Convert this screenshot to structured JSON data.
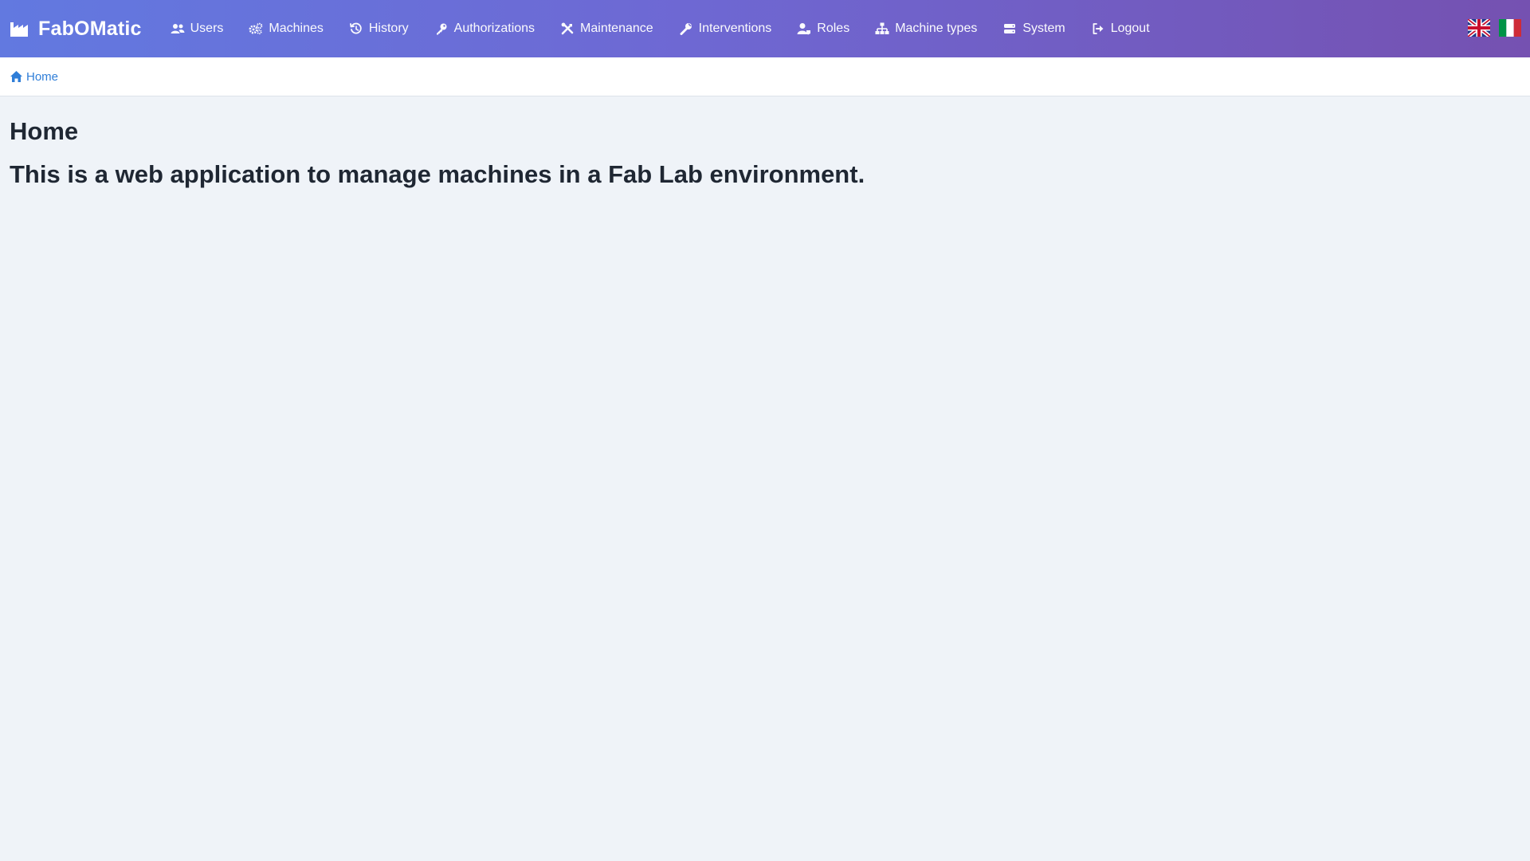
{
  "navbar": {
    "brand": {
      "name": "FabOMatic",
      "icon": "factory-icon"
    },
    "items": [
      {
        "label": "Users",
        "icon": "users-icon"
      },
      {
        "label": "Machines",
        "icon": "cogs-icon"
      },
      {
        "label": "History",
        "icon": "history-icon"
      },
      {
        "label": "Authorizations",
        "icon": "key-icon"
      },
      {
        "label": "Maintenance",
        "icon": "tools-icon"
      },
      {
        "label": "Interventions",
        "icon": "wrench-icon"
      },
      {
        "label": "Roles",
        "icon": "user-tag-icon"
      },
      {
        "label": "Machine types",
        "icon": "sitemap-icon"
      },
      {
        "label": "System",
        "icon": "server-icon"
      },
      {
        "label": "Logout",
        "icon": "logout-icon"
      }
    ],
    "languages": [
      {
        "code": "en",
        "icon": "flag-uk-icon"
      },
      {
        "code": "it",
        "icon": "flag-italy-icon"
      }
    ],
    "colors": {
      "gradient_start": "#6279e0",
      "gradient_end": "#7551b1",
      "text": "#ffffff"
    }
  },
  "breadcrumb": {
    "items": [
      {
        "label": "Home",
        "icon": "home-icon"
      }
    ],
    "link_color": "#2f7ed8"
  },
  "main": {
    "title": "Home",
    "subtitle": "This is a web application to manage machines in a Fab Lab environment."
  }
}
